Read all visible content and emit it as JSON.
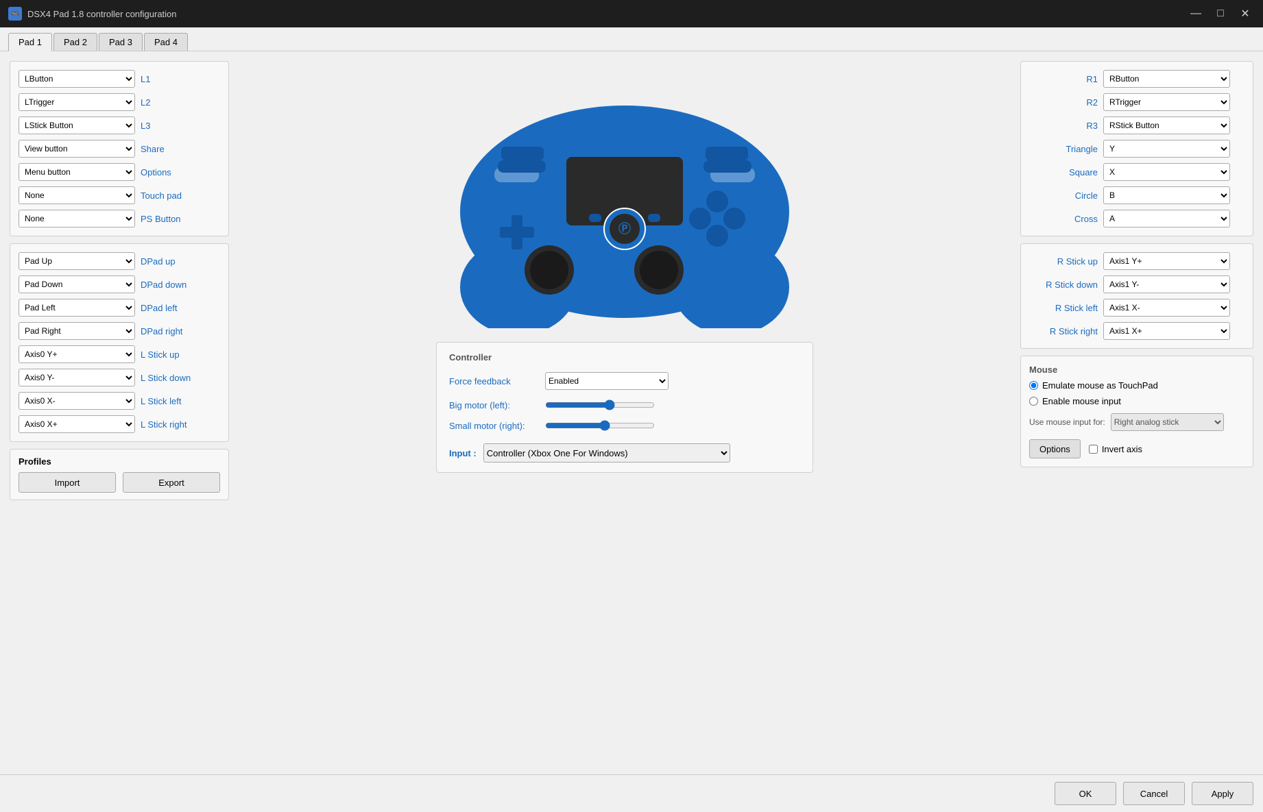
{
  "titleBar": {
    "title": "DSX4 Pad 1.8 controller configuration",
    "minimizeLabel": "—",
    "maximizeLabel": "□",
    "closeLabel": "✕"
  },
  "tabs": [
    {
      "label": "Pad 1",
      "active": true
    },
    {
      "label": "Pad 2",
      "active": false
    },
    {
      "label": "Pad 3",
      "active": false
    },
    {
      "label": "Pad 4",
      "active": false
    }
  ],
  "leftMappings": [
    {
      "label": "L1",
      "value": "LButton"
    },
    {
      "label": "L2",
      "value": "LTrigger"
    },
    {
      "label": "L3",
      "value": "LStick Button"
    },
    {
      "label": "Share",
      "value": "View button"
    },
    {
      "label": "Options",
      "value": "Menu button"
    },
    {
      "label": "Touch pad",
      "value": "None"
    },
    {
      "label": "PS Button",
      "value": "None"
    }
  ],
  "dpadMappings": [
    {
      "label": "DPad up",
      "value": "Pad Up"
    },
    {
      "label": "DPad down",
      "value": "Pad Down"
    },
    {
      "label": "DPad left",
      "value": "Pad Left"
    },
    {
      "label": "DPad right",
      "value": "Pad Right"
    }
  ],
  "lStickMappings": [
    {
      "label": "L Stick up",
      "value": "Axis0 Y+"
    },
    {
      "label": "L Stick down",
      "value": "Axis0 Y-"
    },
    {
      "label": "L Stick left",
      "value": "Axis0 X-"
    },
    {
      "label": "L Stick right",
      "value": "Axis0 X+"
    }
  ],
  "profiles": {
    "title": "Profiles",
    "importLabel": "Import",
    "exportLabel": "Export"
  },
  "rightMappings": [
    {
      "label": "R1",
      "value": "RButton"
    },
    {
      "label": "R2",
      "value": "RTrigger"
    },
    {
      "label": "R3",
      "value": "RStick Button"
    },
    {
      "label": "Triangle",
      "value": "Y"
    },
    {
      "label": "Square",
      "value": "X"
    },
    {
      "label": "Circle",
      "value": "B"
    },
    {
      "label": "Cross",
      "value": "A"
    }
  ],
  "rStickMappings": [
    {
      "label": "R Stick up",
      "value": "Axis1 Y+"
    },
    {
      "label": "R Stick down",
      "value": "Axis1 Y-"
    },
    {
      "label": "R Stick left",
      "value": "Axis1 X-"
    },
    {
      "label": "R Stick right",
      "value": "Axis1 X+"
    }
  ],
  "controller": {
    "sectionTitle": "Controller",
    "forceFeedbackLabel": "Force feedback",
    "forceFeedbackValue": "Enabled",
    "bigMotorLabel": "Big motor (left):",
    "smallMotorLabel": "Small motor (right):",
    "bigMotorValue": 60,
    "smallMotorValue": 55,
    "inputLabel": "Input :",
    "inputValue": "Controller (Xbox One For Windows)"
  },
  "mouse": {
    "sectionTitle": "Mouse",
    "option1": "Emulate mouse as TouchPad",
    "option2": "Enable mouse input",
    "option1Selected": true,
    "useMouseInputLabel": "Use mouse input for:",
    "useMouseInputValue": "Right analog stick",
    "optionsButtonLabel": "Options",
    "invertAxisLabel": "Invert axis"
  },
  "bottomBar": {
    "okLabel": "OK",
    "cancelLabel": "Cancel",
    "applyLabel": "Apply"
  }
}
